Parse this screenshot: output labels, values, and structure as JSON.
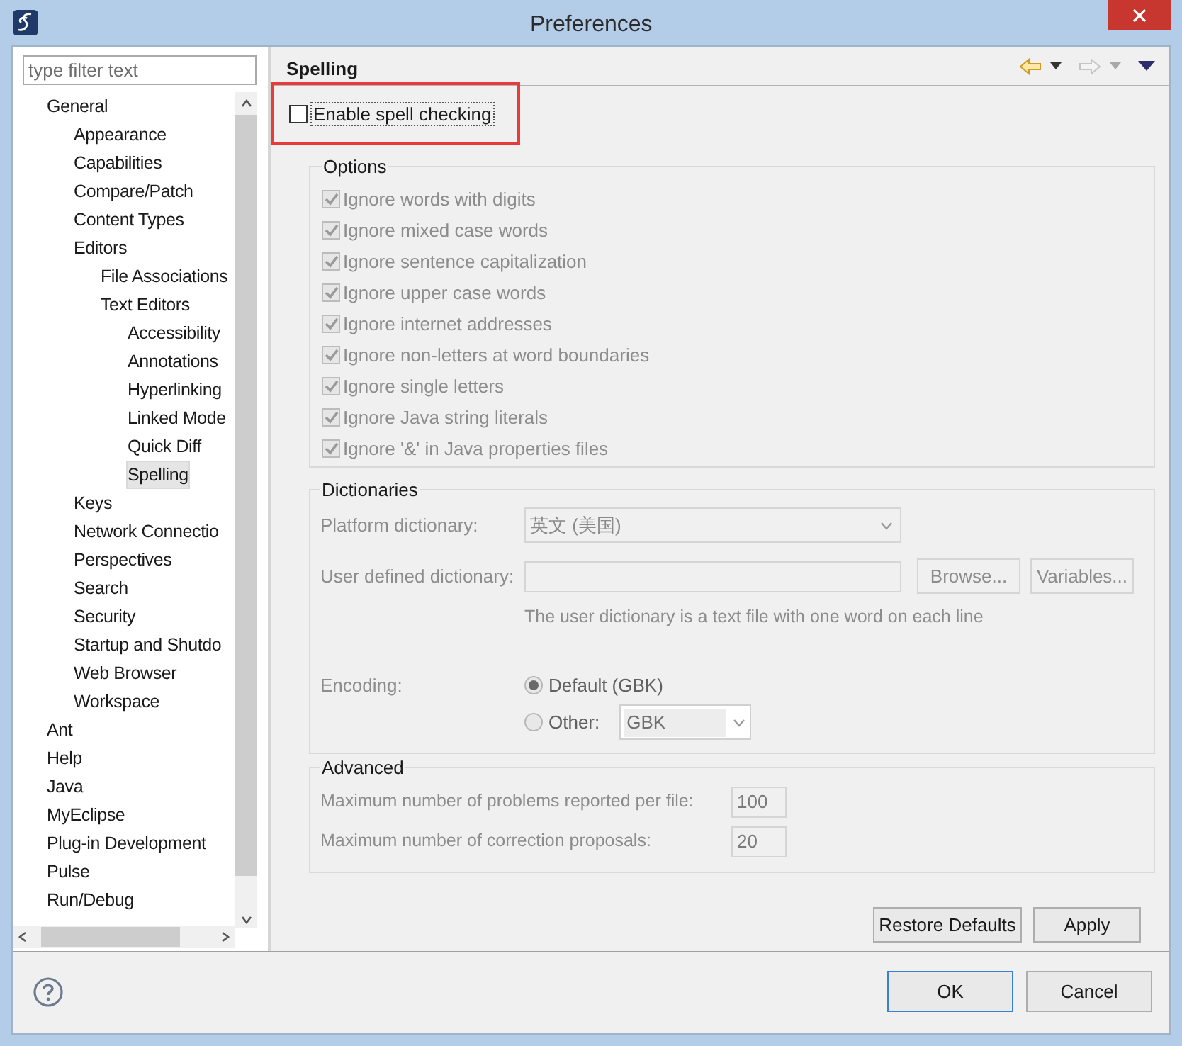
{
  "window": {
    "title": "Preferences"
  },
  "filter": {
    "placeholder": "type filter text"
  },
  "tree": [
    {
      "label": "General",
      "selected": false,
      "children": [
        {
          "label": "Appearance",
          "selected": false
        },
        {
          "label": "Capabilities",
          "selected": false
        },
        {
          "label": "Compare/Patch",
          "selected": false
        },
        {
          "label": "Content Types",
          "selected": false
        },
        {
          "label": "Editors",
          "selected": false,
          "children": [
            {
              "label": "File Associations",
              "selected": false
            },
            {
              "label": "Text Editors",
              "selected": false,
              "children": [
                {
                  "label": "Accessibility",
                  "selected": false
                },
                {
                  "label": "Annotations",
                  "selected": false
                },
                {
                  "label": "Hyperlinking",
                  "selected": false
                },
                {
                  "label": "Linked Mode",
                  "selected": false
                },
                {
                  "label": "Quick Diff",
                  "selected": false
                },
                {
                  "label": "Spelling",
                  "selected": true
                }
              ]
            }
          ]
        },
        {
          "label": "Keys",
          "selected": false
        },
        {
          "label": "Network Connectio",
          "selected": false
        },
        {
          "label": "Perspectives",
          "selected": false
        },
        {
          "label": "Search",
          "selected": false
        },
        {
          "label": "Security",
          "selected": false
        },
        {
          "label": "Startup and Shutdo",
          "selected": false
        },
        {
          "label": "Web Browser",
          "selected": false
        },
        {
          "label": "Workspace",
          "selected": false
        }
      ]
    },
    {
      "label": "Ant",
      "selected": false
    },
    {
      "label": "Help",
      "selected": false
    },
    {
      "label": "Java",
      "selected": false
    },
    {
      "label": "MyEclipse",
      "selected": false
    },
    {
      "label": "Plug-in Development",
      "selected": false
    },
    {
      "label": "Pulse",
      "selected": false
    },
    {
      "label": "Run/Debug",
      "selected": false
    }
  ],
  "page": {
    "title": "Spelling",
    "enable": {
      "label": "Enable spell checking",
      "checked": false,
      "highlighted": true
    },
    "options": {
      "title": "Options",
      "items": [
        {
          "label": "Ignore words with digits",
          "checked": true,
          "disabled": true
        },
        {
          "label": "Ignore mixed case words",
          "checked": true,
          "disabled": true
        },
        {
          "label": "Ignore sentence capitalization",
          "checked": true,
          "disabled": true
        },
        {
          "label": "Ignore upper case words",
          "checked": true,
          "disabled": true
        },
        {
          "label": "Ignore internet addresses",
          "checked": true,
          "disabled": true
        },
        {
          "label": "Ignore non-letters at word boundaries",
          "checked": true,
          "disabled": true
        },
        {
          "label": "Ignore single letters",
          "checked": true,
          "disabled": true
        },
        {
          "label": "Ignore Java string literals",
          "checked": true,
          "disabled": true
        },
        {
          "label": "Ignore '&' in Java properties files",
          "checked": true,
          "disabled": true
        }
      ]
    },
    "dictionaries": {
      "title": "Dictionaries",
      "platform_label": "Platform dictionary:",
      "platform_value": "英文 (美国)",
      "user_label": "User defined dictionary:",
      "browse": "Browse...",
      "variables": "Variables...",
      "hint": "The user dictionary is a text file with one word on each line",
      "encoding_label": "Encoding:",
      "encodings": [
        {
          "label": "Default (GBK)",
          "selected": true
        },
        {
          "label": "Other:",
          "selected": false
        }
      ],
      "other_value": "GBK"
    },
    "advanced": {
      "title": "Advanced",
      "fields": [
        {
          "label": "Maximum number of problems reported per file:",
          "value": "100"
        },
        {
          "label": "Maximum number of correction proposals:",
          "value": "20"
        }
      ]
    },
    "buttons": [
      "Restore Defaults",
      "Apply"
    ]
  },
  "dialog_buttons": [
    "OK",
    "Cancel"
  ]
}
